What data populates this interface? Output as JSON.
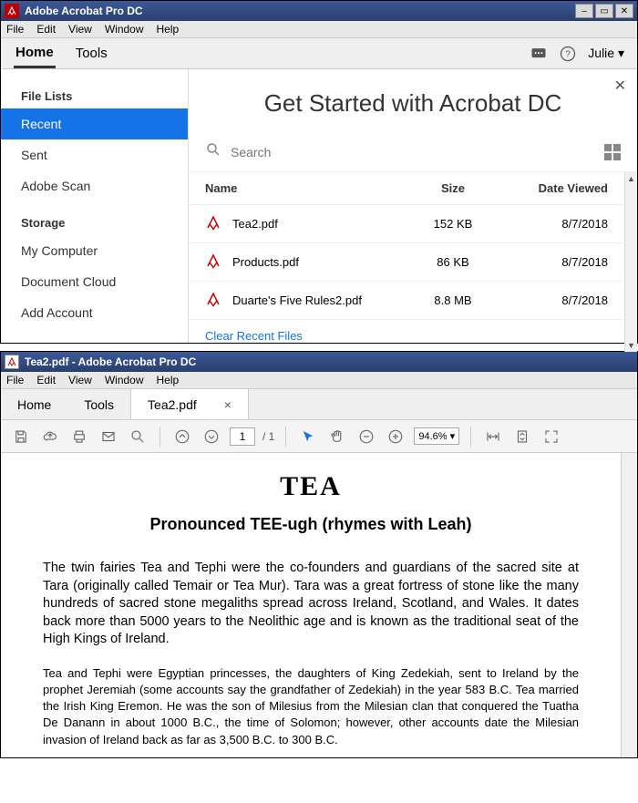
{
  "window1": {
    "title": "Adobe Acrobat Pro DC",
    "menubar": [
      "File",
      "Edit",
      "View",
      "Window",
      "Help"
    ],
    "tabs": {
      "home": "Home",
      "tools": "Tools"
    },
    "user": "Julie",
    "sidebar": {
      "lists_hdr": "File Lists",
      "lists": [
        "Recent",
        "Sent",
        "Adobe Scan"
      ],
      "storage_hdr": "Storage",
      "storage": [
        "My Computer",
        "Document Cloud",
        "Add Account"
      ]
    },
    "hero": "Get Started with Acrobat DC",
    "search_placeholder": "Search",
    "columns": {
      "name": "Name",
      "size": "Size",
      "date": "Date Viewed"
    },
    "rows": [
      {
        "name": "Tea2.pdf",
        "size": "152 KB",
        "date": "8/7/2018"
      },
      {
        "name": "Products.pdf",
        "size": "86 KB",
        "date": "8/7/2018"
      },
      {
        "name": "Duarte's Five Rules2.pdf",
        "size": "8.8 MB",
        "date": "8/7/2018"
      }
    ],
    "clear": "Clear Recent Files"
  },
  "window2": {
    "title": "Tea2.pdf - Adobe Acrobat Pro DC",
    "menubar": [
      "File",
      "Edit",
      "View",
      "Window",
      "Help"
    ],
    "tabs": {
      "home": "Home",
      "tools": "Tools",
      "file": "Tea2.pdf"
    },
    "page_current": "1",
    "page_total": "/ 1",
    "zoom": "94.6%",
    "doc": {
      "title": "TEA",
      "subtitle": "Pronounced TEE-ugh (rhymes with Leah)",
      "p1": "The twin fairies Tea and Tephi were the co-founders and guardians of the sacred site at Tara (originally called Temair or Tea Mur). Tara was a great fortress of stone like the many hundreds of sacred stone megaliths spread across Ireland, Scotland, and Wales. It dates back more than 5000 years to the Neolithic age and is known as the traditional seat of the High Kings of Ireland.",
      "p2": "Tea and Tephi were Egyptian princesses, the daughters of King Zedekiah, sent to Ireland by the prophet Jeremiah (some accounts say the grandfather of Zedekiah) in the year 583 B.C. Tea married the Irish King Eremon. He was the son of Milesius from the Milesian clan that conquered the Tuatha De Danann in about 1000 B.C., the time of Solomon; however, other accounts date the Milesian invasion of Ireland back as far as 3,500 B.C. to 300 B.C."
    }
  }
}
